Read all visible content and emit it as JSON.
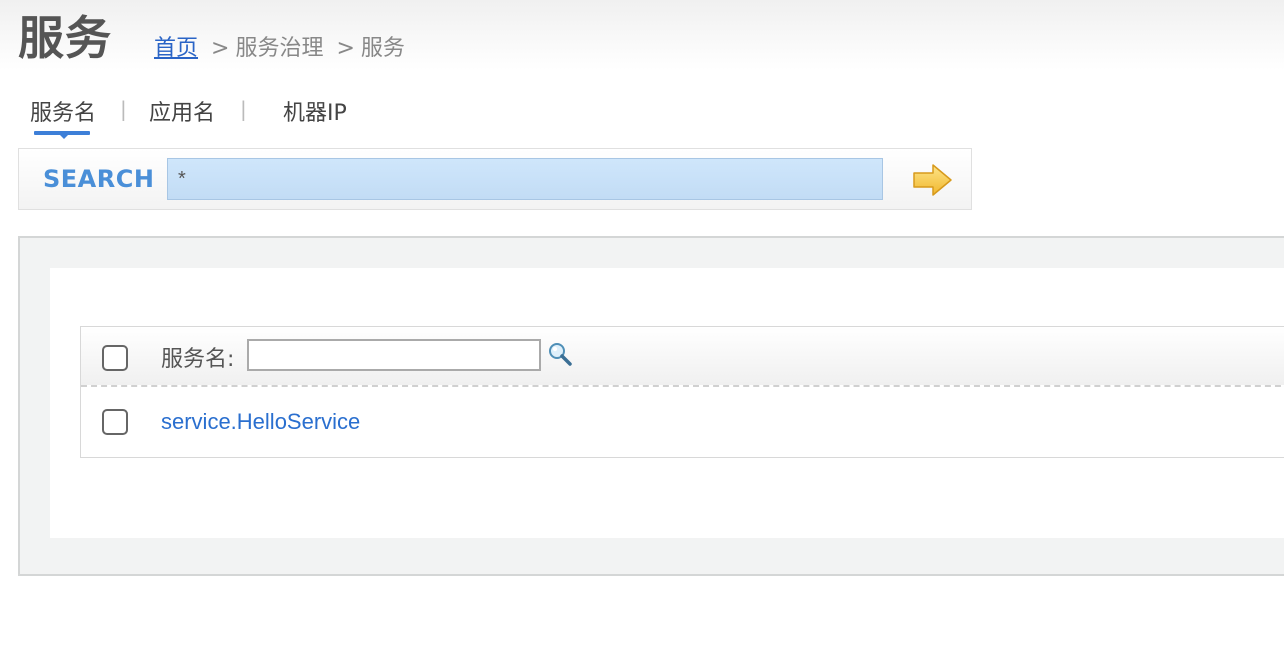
{
  "header": {
    "title": "服务",
    "breadcrumb": {
      "home": "首页",
      "sep1": ">",
      "level1": "服务治理",
      "sep2": ">",
      "current": "服务"
    }
  },
  "tabs": {
    "items": [
      {
        "label": "服务名"
      },
      {
        "label": "应用名"
      },
      {
        "label": "机器IP"
      }
    ],
    "divider": "|",
    "active_index": 0
  },
  "search": {
    "label": "SEARCH",
    "value": "*",
    "go_icon": "arrow-right-icon"
  },
  "table": {
    "header_label": "服务名:",
    "filter_value": "",
    "filter_icon": "magnifier-icon",
    "rows": [
      {
        "name": "service.HelloService",
        "checked": false
      }
    ],
    "select_all_checked": false
  },
  "colors": {
    "link": "#2a6fcf",
    "accent": "#3d7fd8",
    "search_label": "#4a8fd8",
    "search_input_bg": "#cfe6fb",
    "arrow": "#f2c23e"
  }
}
